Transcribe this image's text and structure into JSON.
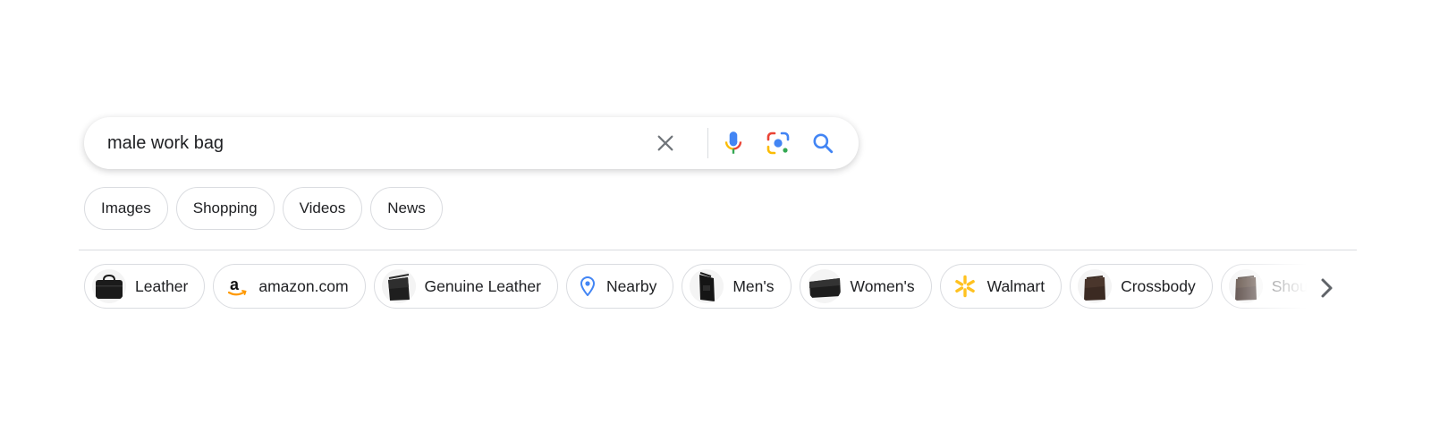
{
  "search": {
    "value": "male work bag",
    "clear_icon": "close-icon",
    "voice_icon": "microphone-icon",
    "lens_icon": "camera-lens-icon",
    "search_icon": "search-icon"
  },
  "tabs": [
    {
      "label": "Images"
    },
    {
      "label": "Shopping"
    },
    {
      "label": "Videos"
    },
    {
      "label": "News"
    }
  ],
  "chips": [
    {
      "label": "Leather",
      "icon": "briefcase-thumbnail"
    },
    {
      "label": "amazon.com",
      "icon": "amazon-logo-icon"
    },
    {
      "label": "Genuine Leather",
      "icon": "messenger-bag-thumbnail"
    },
    {
      "label": "Nearby",
      "icon": "location-pin-icon"
    },
    {
      "label": "Men's",
      "icon": "shoulder-bag-thumbnail"
    },
    {
      "label": "Women's",
      "icon": "laptop-bag-thumbnail"
    },
    {
      "label": "Walmart",
      "icon": "walmart-spark-icon"
    },
    {
      "label": "Crossbody",
      "icon": "crossbody-bag-thumbnail"
    },
    {
      "label": "Shoulder",
      "icon": "brown-bag-thumbnail"
    }
  ],
  "chips_next_icon": "chevron-right-icon",
  "colors": {
    "google_blue": "#4285f4",
    "google_red": "#ea4335",
    "google_yellow": "#fbbc04",
    "google_green": "#34a853",
    "walmart_yellow": "#ffc220",
    "border": "#dadce0",
    "text": "#202124"
  }
}
